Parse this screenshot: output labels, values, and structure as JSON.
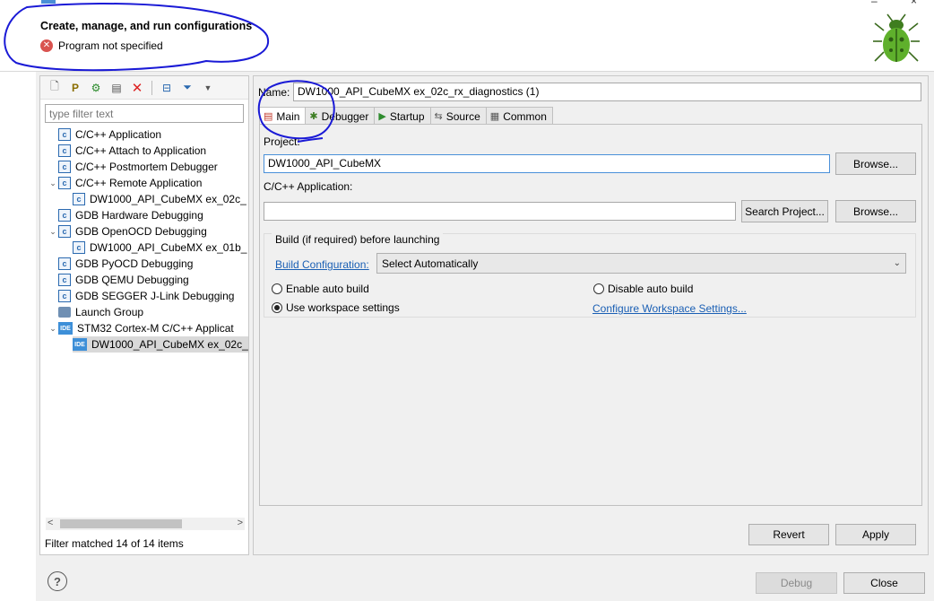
{
  "header": {
    "title": "Create, manage, and run configurations",
    "error": "Program not specified"
  },
  "toolbar": {
    "icons": [
      "new-configuration-icon",
      "new-prototype-icon",
      "duplicate-icon",
      "export-icon",
      "delete-icon",
      "collapse-all-icon",
      "filter-icon",
      "dropdown-icon"
    ]
  },
  "filter": {
    "placeholder": "type filter text",
    "status": "Filter matched 14 of 14 items"
  },
  "tree": [
    {
      "label": "C/C++ Application",
      "depth": 0,
      "expander": "",
      "icon": "c"
    },
    {
      "label": "C/C++ Attach to Application",
      "depth": 0,
      "expander": "",
      "icon": "c"
    },
    {
      "label": "C/C++ Postmortem Debugger",
      "depth": 0,
      "expander": "",
      "icon": "c"
    },
    {
      "label": "C/C++ Remote Application",
      "depth": 0,
      "expander": "v",
      "icon": "c"
    },
    {
      "label": "DW1000_API_CubeMX ex_02c_",
      "depth": 1,
      "expander": "",
      "icon": "c"
    },
    {
      "label": "GDB Hardware Debugging",
      "depth": 0,
      "expander": "",
      "icon": "c"
    },
    {
      "label": "GDB OpenOCD Debugging",
      "depth": 0,
      "expander": "v",
      "icon": "c"
    },
    {
      "label": "DW1000_API_CubeMX ex_01b_",
      "depth": 1,
      "expander": "",
      "icon": "c"
    },
    {
      "label": "GDB PyOCD Debugging",
      "depth": 0,
      "expander": "",
      "icon": "c"
    },
    {
      "label": "GDB QEMU Debugging",
      "depth": 0,
      "expander": "",
      "icon": "c"
    },
    {
      "label": "GDB SEGGER J-Link Debugging",
      "depth": 0,
      "expander": "",
      "icon": "c"
    },
    {
      "label": "Launch Group",
      "depth": 0,
      "expander": "",
      "icon": "launch"
    },
    {
      "label": "STM32 Cortex-M C/C++ Applicat",
      "depth": 0,
      "expander": "v",
      "icon": "ide"
    },
    {
      "label": "DW1000_API_CubeMX ex_02c_",
      "depth": 1,
      "expander": "",
      "icon": "ide",
      "selected": true
    }
  ],
  "config": {
    "name_label": "Name:",
    "name_value": "DW1000_API_CubeMX ex_02c_rx_diagnostics (1)",
    "tabs": [
      {
        "label": "Main",
        "icon": "main-tab-icon"
      },
      {
        "label": "Debugger",
        "icon": "debugger-tab-icon"
      },
      {
        "label": "Startup",
        "icon": "startup-tab-icon"
      },
      {
        "label": "Source",
        "icon": "source-tab-icon"
      },
      {
        "label": "Common",
        "icon": "common-tab-icon"
      }
    ],
    "project_label": "Project:",
    "project_value": "DW1000_API_CubeMX",
    "browse_label": "Browse...",
    "app_label": "C/C++ Application:",
    "app_value": "",
    "search_project_label": "Search Project...",
    "build_group_label": "Build (if required) before launching",
    "build_config_link": "Build Configuration:",
    "build_config_value": "Select Automatically",
    "enable_auto_build": "Enable auto build",
    "disable_auto_build": "Disable auto build",
    "use_workspace_settings": "Use workspace settings",
    "configure_workspace_link": "Configure Workspace Settings...",
    "revert_label": "Revert",
    "apply_label": "Apply"
  },
  "footer": {
    "help": "?",
    "debug_label": "Debug",
    "close_label": "Close"
  },
  "colors": {
    "annotation": "#1a1ad6",
    "error": "#d9534f",
    "link": "#1a5fb4"
  }
}
